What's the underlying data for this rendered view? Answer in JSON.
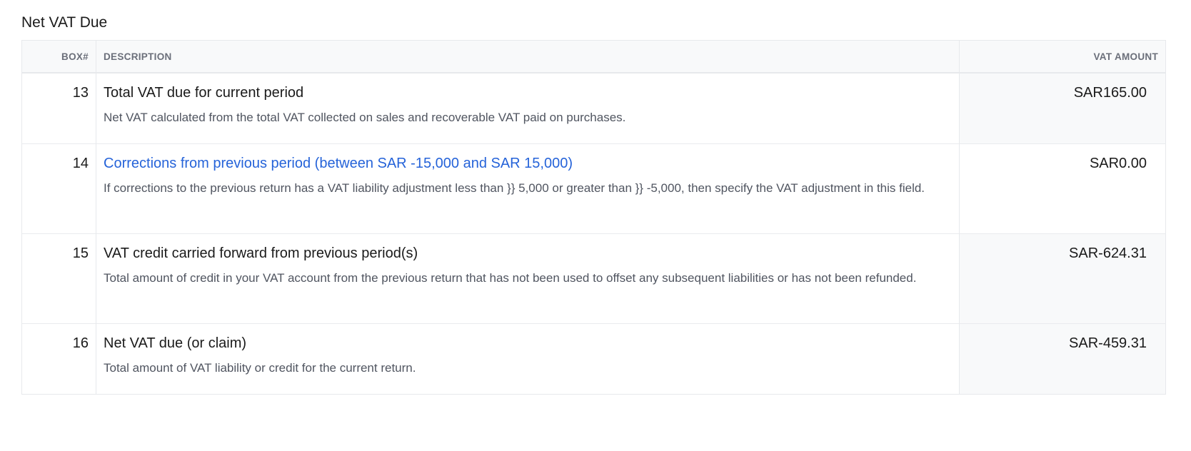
{
  "section": {
    "title": "Net VAT Due"
  },
  "table": {
    "headers": {
      "box": "BOX#",
      "description": "DESCRIPTION",
      "amount": "VAT AMOUNT"
    },
    "rows": [
      {
        "box": "13",
        "label": "Total VAT due for current period",
        "help": "Net VAT calculated from the total VAT collected on sales and recoverable VAT paid on purchases.",
        "amount": "SAR165.00",
        "is_link": false,
        "amount_shaded": true
      },
      {
        "box": "14",
        "label": "Corrections from previous period (between SAR -15,000 and SAR 15,000)",
        "help": "If corrections to the previous return has a VAT liability adjustment less than }} 5,000 or greater than }} -5,000, then specify the VAT adjustment in this field.",
        "amount": "SAR0.00",
        "is_link": true,
        "amount_shaded": false
      },
      {
        "box": "15",
        "label": "VAT credit carried forward from previous period(s)",
        "help": "Total amount of credit in your VAT account from the previous return that has not been used to offset any subsequent liabilities or has not been refunded.",
        "amount": "SAR-624.31",
        "is_link": false,
        "amount_shaded": true
      },
      {
        "box": "16",
        "label": "Net VAT due (or claim)",
        "help": "Total amount of VAT liability or credit for the current return.",
        "amount": "SAR-459.31",
        "is_link": false,
        "amount_shaded": true
      }
    ]
  },
  "colors": {
    "link": "#2563d9",
    "header_bg": "#f8f9fa",
    "border": "#e7e9ec",
    "help_text": "#505560"
  }
}
